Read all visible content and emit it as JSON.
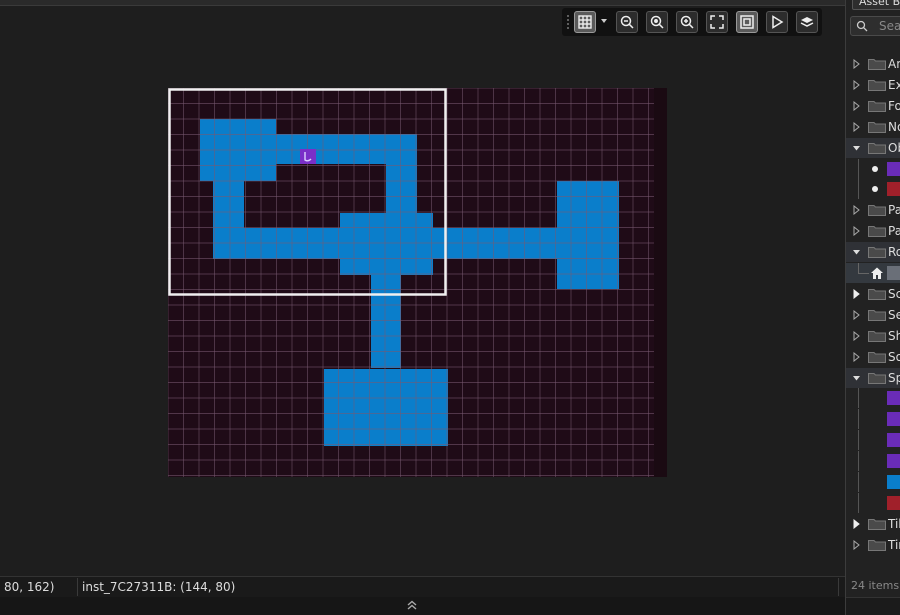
{
  "toolbar": {
    "buttons": [
      {
        "name": "toggle-grid-button",
        "icon": "grid-icon",
        "active": true
      },
      {
        "name": "zoom-out-button",
        "icon": "zoom-out-icon",
        "active": false
      },
      {
        "name": "zoom-reset-button",
        "icon": "zoom-reset-icon",
        "active": false
      },
      {
        "name": "zoom-in-button",
        "icon": "zoom-in-icon",
        "active": false
      },
      {
        "name": "fit-view-button",
        "icon": "fit-view-icon",
        "active": false
      },
      {
        "name": "room-view-button",
        "icon": "frame-icon",
        "active": true
      },
      {
        "name": "play-button",
        "icon": "play-icon",
        "active": false
      },
      {
        "name": "layer-button",
        "icon": "layer-icon",
        "active": false
      }
    ]
  },
  "status": {
    "cursor_position": "80, 162)",
    "instance_info": "inst_7C27311B: (144, 80)"
  },
  "asset_browser": {
    "title": "Asset Br",
    "search_placeholder": "Sear",
    "items_count": "24 items",
    "tree": [
      {
        "type": "folder",
        "label": "An",
        "expanded": false
      },
      {
        "type": "folder",
        "label": "Ex",
        "expanded": false
      },
      {
        "type": "folder",
        "label": "Fo",
        "expanded": false
      },
      {
        "type": "folder",
        "label": "No",
        "expanded": false
      },
      {
        "type": "folder",
        "label": "Ob",
        "expanded": true,
        "highlight": true
      },
      {
        "type": "asset",
        "thumb": "purple-sprite"
      },
      {
        "type": "asset",
        "thumb": "red-sprite"
      },
      {
        "type": "folder",
        "label": "Pa",
        "expanded": false
      },
      {
        "type": "folder",
        "label": "Pa",
        "expanded": false
      },
      {
        "type": "folder",
        "label": "Ro",
        "expanded": true,
        "highlight": true
      },
      {
        "type": "room",
        "icon": "home-icon",
        "selected": true
      },
      {
        "type": "folder",
        "label": "Sc",
        "expanded": false,
        "bright": true
      },
      {
        "type": "folder",
        "label": "Se",
        "expanded": false
      },
      {
        "type": "folder",
        "label": "Sh",
        "expanded": false
      },
      {
        "type": "folder",
        "label": "So",
        "expanded": false
      },
      {
        "type": "folder",
        "label": "Sp",
        "expanded": true,
        "highlight": true
      },
      {
        "type": "asset",
        "thumb": "purple-sprite"
      },
      {
        "type": "asset",
        "thumb": "purple-sprite"
      },
      {
        "type": "asset",
        "thumb": "purple-sprite"
      },
      {
        "type": "asset",
        "thumb": "purple-sprite"
      },
      {
        "type": "asset",
        "thumb": "blue-tile"
      },
      {
        "type": "asset",
        "thumb": "red-sprite"
      },
      {
        "type": "folder",
        "label": "Til",
        "expanded": false,
        "bright": true
      },
      {
        "type": "folder",
        "label": "Tir",
        "expanded": false
      }
    ]
  },
  "room": {
    "background_color": "#1f0b17",
    "grid_color": "#7a5a72",
    "floor_color": "#0a7ecb",
    "floor_grid_color": "#54a8dd",
    "camera_color": "#f0f0f0",
    "player_color": "#7a2fc8"
  }
}
